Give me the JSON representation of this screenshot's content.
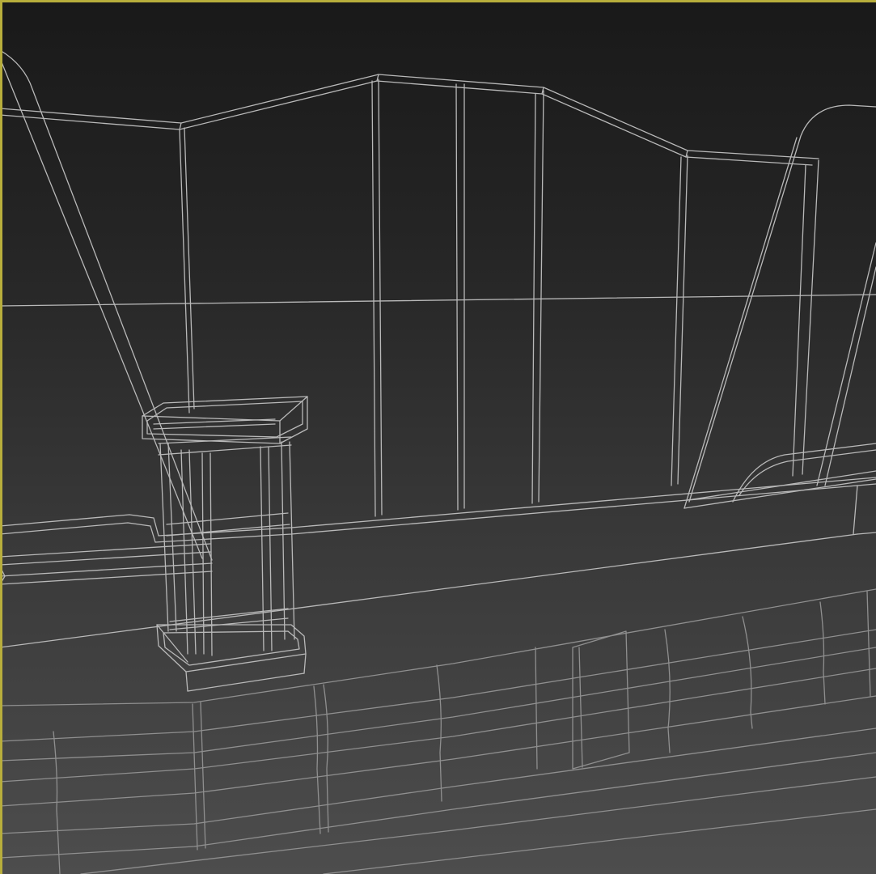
{
  "viewport": {
    "mode": "wireframe",
    "active": true,
    "colors": {
      "wire": "#b9b9b9",
      "wire_dim": "#8f8f8f",
      "active_border": "#b8ae3c",
      "background_top": "#191919",
      "background_bottom": "#4d4d4d"
    }
  }
}
